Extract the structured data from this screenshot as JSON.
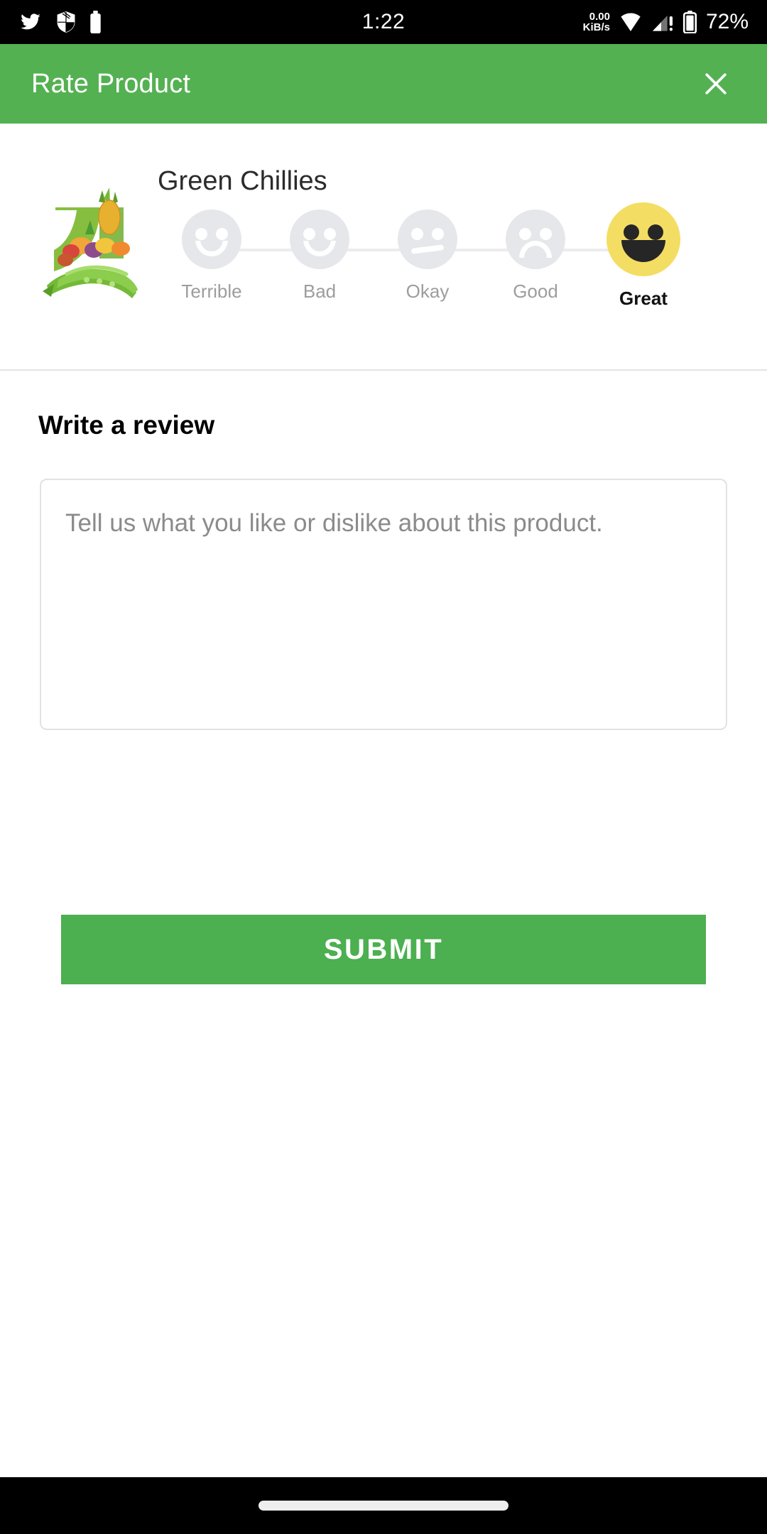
{
  "status_bar": {
    "time": "1:22",
    "network_speed_value": "0.00",
    "network_speed_unit": "KiB/s",
    "battery_percent": "72%",
    "left_icons": [
      "twitter-icon",
      "shield-icon",
      "battery-saver-icon"
    ],
    "right_icons": [
      "wifi-icon",
      "cellular-signal-alert-icon",
      "battery-icon"
    ],
    "background": "#000000",
    "foreground": "#ffffff"
  },
  "app_bar": {
    "title": "Rate Product",
    "close_icon": "close-icon",
    "background": "#54b152",
    "text_color": "#ffffff"
  },
  "rating_card": {
    "product_name": "Green Chillies",
    "product_image_alt": "fresh-produce-logo",
    "selected_index": 4,
    "selected_label": "Great",
    "selected_color": "#f4dd63",
    "unselected_color": "#e6e7ea",
    "options": [
      {
        "label": "Terrible",
        "mood": "frown-deep",
        "selected": false
      },
      {
        "label": "Bad",
        "mood": "frown",
        "selected": false
      },
      {
        "label": "Okay",
        "mood": "neutral",
        "selected": false
      },
      {
        "label": "Good",
        "mood": "smile",
        "selected": false
      },
      {
        "label": "Great",
        "mood": "grin-open",
        "selected": true
      }
    ]
  },
  "review": {
    "heading": "Write a review",
    "placeholder": "Tell us what you like or dislike about this product.",
    "value": ""
  },
  "submit": {
    "label": "SUBMIT",
    "background": "#4caf50",
    "text_color": "#ffffff"
  },
  "nav_bar": {
    "gesture_pill": "home-gesture-pill",
    "background": "#000000"
  }
}
